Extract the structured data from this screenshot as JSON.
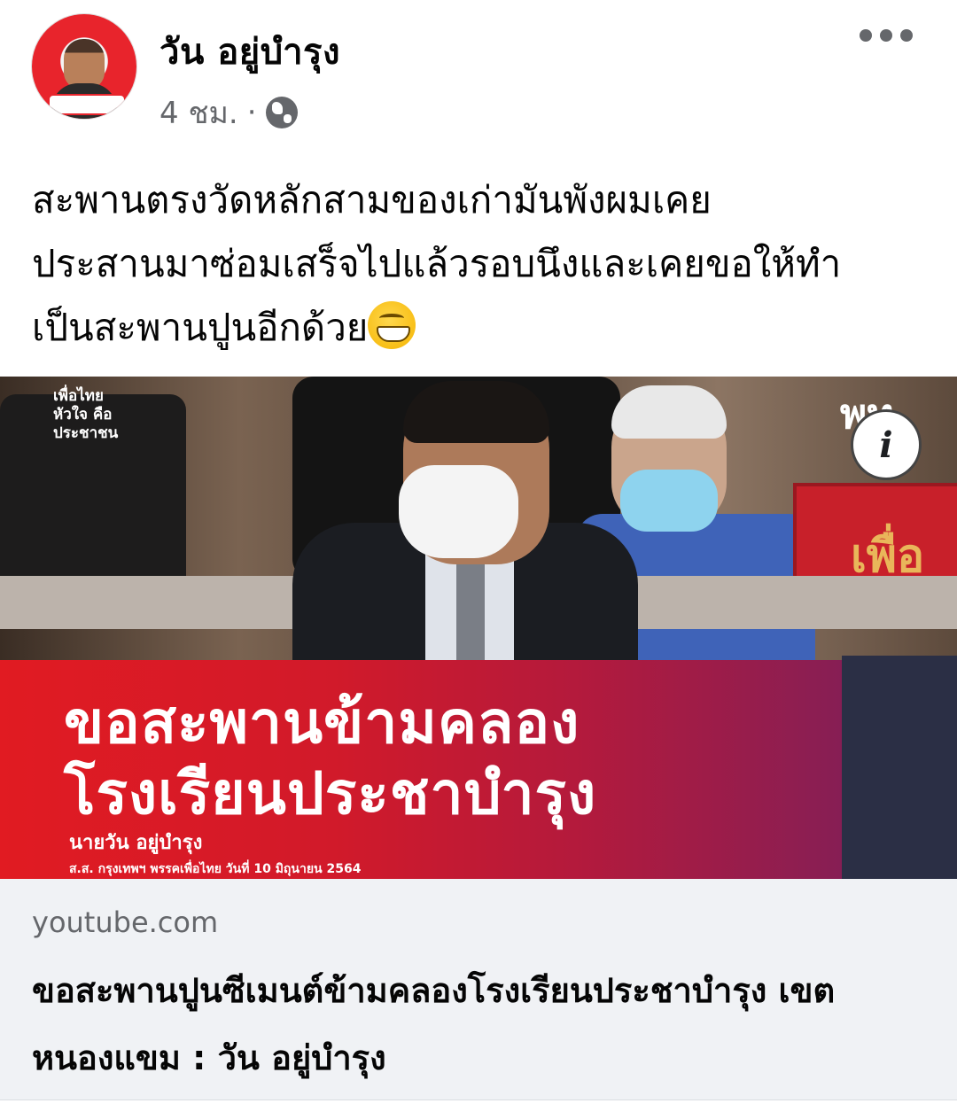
{
  "post": {
    "author": "วัน อยู่บำรุง",
    "time": "4 ชม.",
    "separator": "·",
    "privacy_icon": "globe-icon",
    "more_icon": "more-options-icon",
    "text_lines": [
      "สะพานตรงวัดหลักสามของเก่ามันพังผมเคย",
      "ประสานมาซ่อมเสร็จไปแล้วรอบนึงและเคยขอให้ทำ",
      "เป็นสะพานปูนอีกด้วย"
    ],
    "emoji": "grinning-face-emoji"
  },
  "link_preview": {
    "thumbnail": {
      "logo_top_left": [
        "เพื่อไทย",
        "หัวใจ คือ",
        "ประชาชน"
      ],
      "logo_top_right": "พท",
      "nameplate": "เพื่อ",
      "headline_line1": "ขอสะพานข้ามคลอง",
      "headline_line2": "โรงเรียนประชาบำรุง",
      "speaker_name": "นายวัน อยู่บำรุง",
      "speaker_sub": "ส.ส. กรุงเทพฯ  พรรคเพื่อไทย วันที่ 10 มิถุนายน 2564",
      "info_icon": "info-icon",
      "info_label": "i"
    },
    "domain": "youtube.com",
    "title": "ขอสะพานปูนซีเมนต์ข้ามคลองโรงเรียนประชาบำรุง เขตหนองแขม : วัน อยู่บำรุง"
  },
  "colors": {
    "banner_red": "#e11b22",
    "banner_purple": "#6f1f5c",
    "meta_gray": "#65676b",
    "card_bg": "#f0f2f5"
  }
}
